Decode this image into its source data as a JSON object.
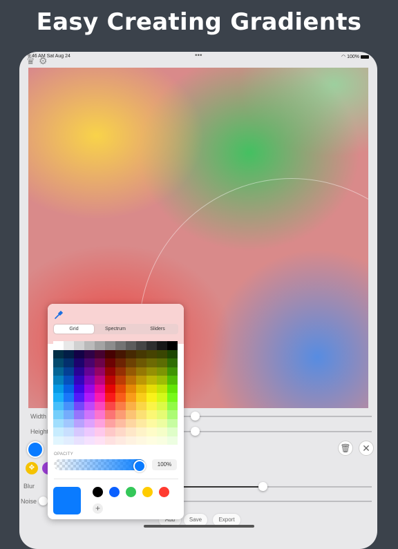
{
  "headline": "Easy Creating Gradients",
  "status": {
    "time": "9:46 AM",
    "date": "Sat Aug 24",
    "battery": "100%"
  },
  "toolbar": {
    "crown_icon": "crown-icon",
    "gear_icon": "gear-icon"
  },
  "controls": {
    "width_label": "Width",
    "height_label": "Height",
    "blur_label": "Blur",
    "noise_label": "Noise",
    "width_value": 0.32,
    "height_value": 0.32,
    "blur_value": 0.68
  },
  "bottom_buttons": {
    "add": "Add",
    "save": "Save",
    "export": "Export"
  },
  "picker": {
    "tabs": [
      "Grid",
      "Spectrum",
      "Sliders"
    ],
    "active_tab": "Grid",
    "opacity_label": "OPACITY",
    "opacity_value": "100%",
    "current_color": "#0A7BFF",
    "swatches": [
      "#000000",
      "#0A60FF",
      "#34C759",
      "#FFCC00",
      "#FF3B30"
    ]
  },
  "stops": {
    "selected_color": "#0A7BFF",
    "stop_yellow": "#F5C200",
    "stop_purple": "#9B3FD6"
  }
}
